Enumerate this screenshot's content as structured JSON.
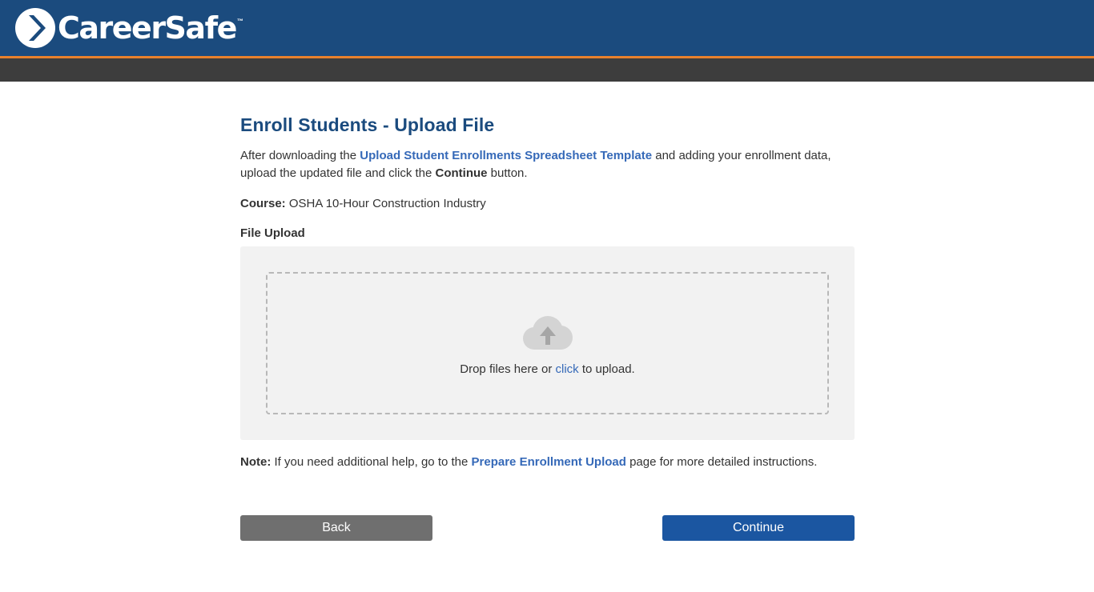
{
  "header": {
    "logo_text": "CareerSafe",
    "logo_tm": "™",
    "colors": {
      "header_bg": "#1b4b7e",
      "accent": "#e8812c",
      "subbar_bg": "#3d3d3d"
    }
  },
  "main": {
    "title": "Enroll Students - Upload File",
    "intro": {
      "before": "After downloading the ",
      "template_link": "Upload Student Enrollments Spreadsheet Template",
      "middle": " and adding your enrollment data, upload the updated file and click the ",
      "continue_word": "Continue",
      "after": " button."
    },
    "course": {
      "label": "Course:",
      "value": " OSHA 10-Hour Construction Industry"
    },
    "file_upload": {
      "label": "File Upload",
      "icon": "cloud-upload-icon",
      "drop_before": "Drop files here or ",
      "click_link": "click",
      "drop_after": " to upload."
    },
    "note": {
      "label": "Note:",
      "before": " If you need additional help, go to the ",
      "link": "Prepare Enrollment Upload",
      "after": " page for more detailed instructions."
    }
  },
  "buttons": {
    "back": "Back",
    "continue": "Continue",
    "colors": {
      "back": "#6f6f6f",
      "continue": "#1b56a1"
    }
  }
}
